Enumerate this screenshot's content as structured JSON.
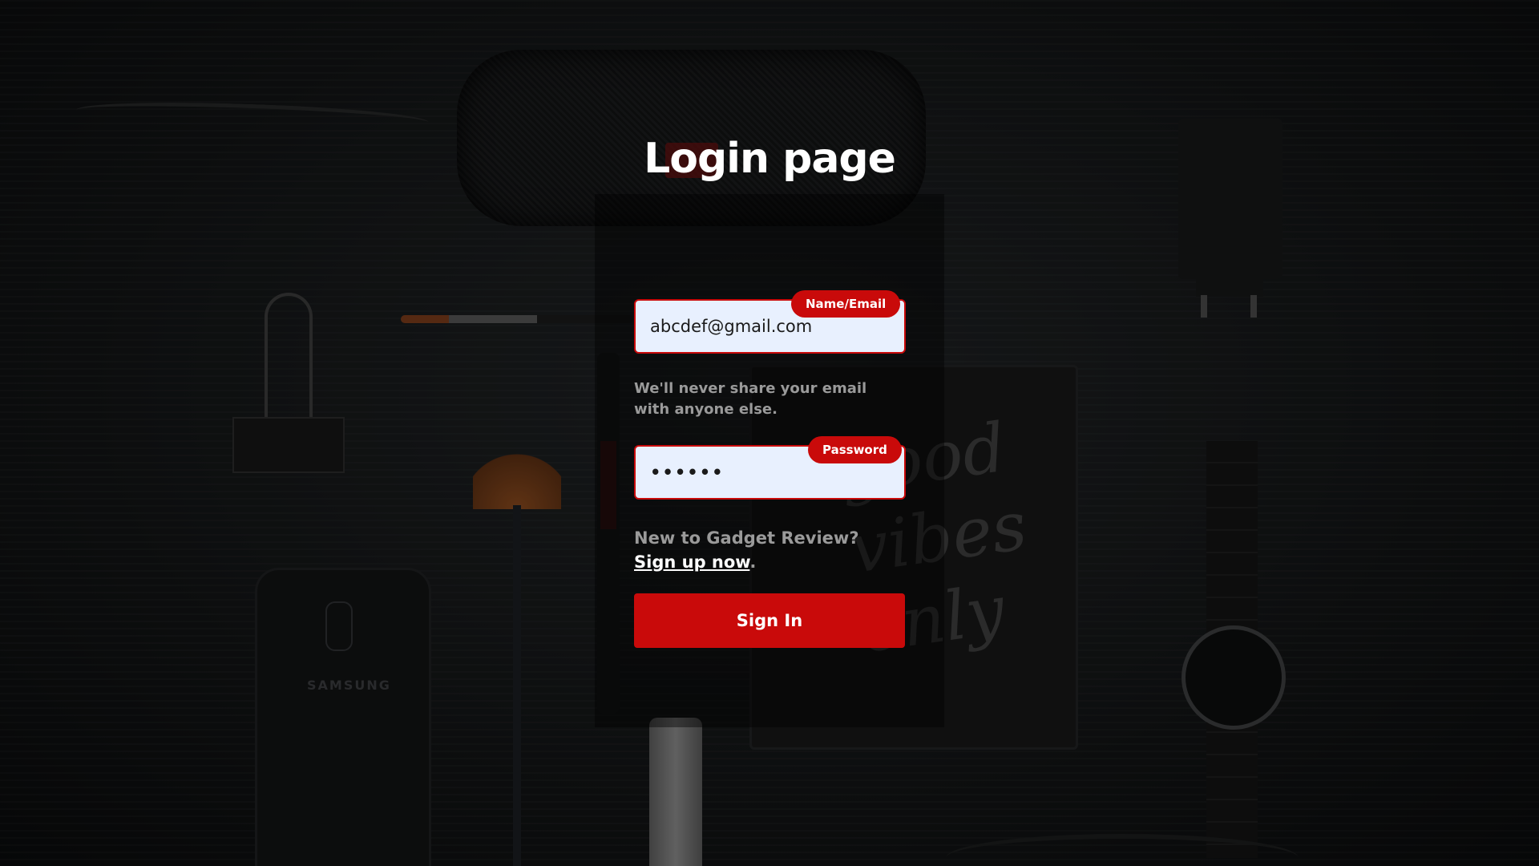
{
  "page": {
    "title": "Login page"
  },
  "background": {
    "phone_brand": "SAMSUNG"
  },
  "form": {
    "email": {
      "badge": "Name/Email",
      "value": "abcdef@gmail.com"
    },
    "email_help": "We'll never share your email with anyone else.",
    "password": {
      "badge": "Password",
      "value": "••••••"
    },
    "signup_prefix": "New to Gadget Review? ",
    "signup_link": "Sign up now",
    "signup_suffix": ".",
    "submit_label": "Sign In"
  },
  "colors": {
    "accent": "#c90a0a",
    "field_bg": "#e8f0fe",
    "muted_text": "#9a9a9a"
  },
  "icons": []
}
